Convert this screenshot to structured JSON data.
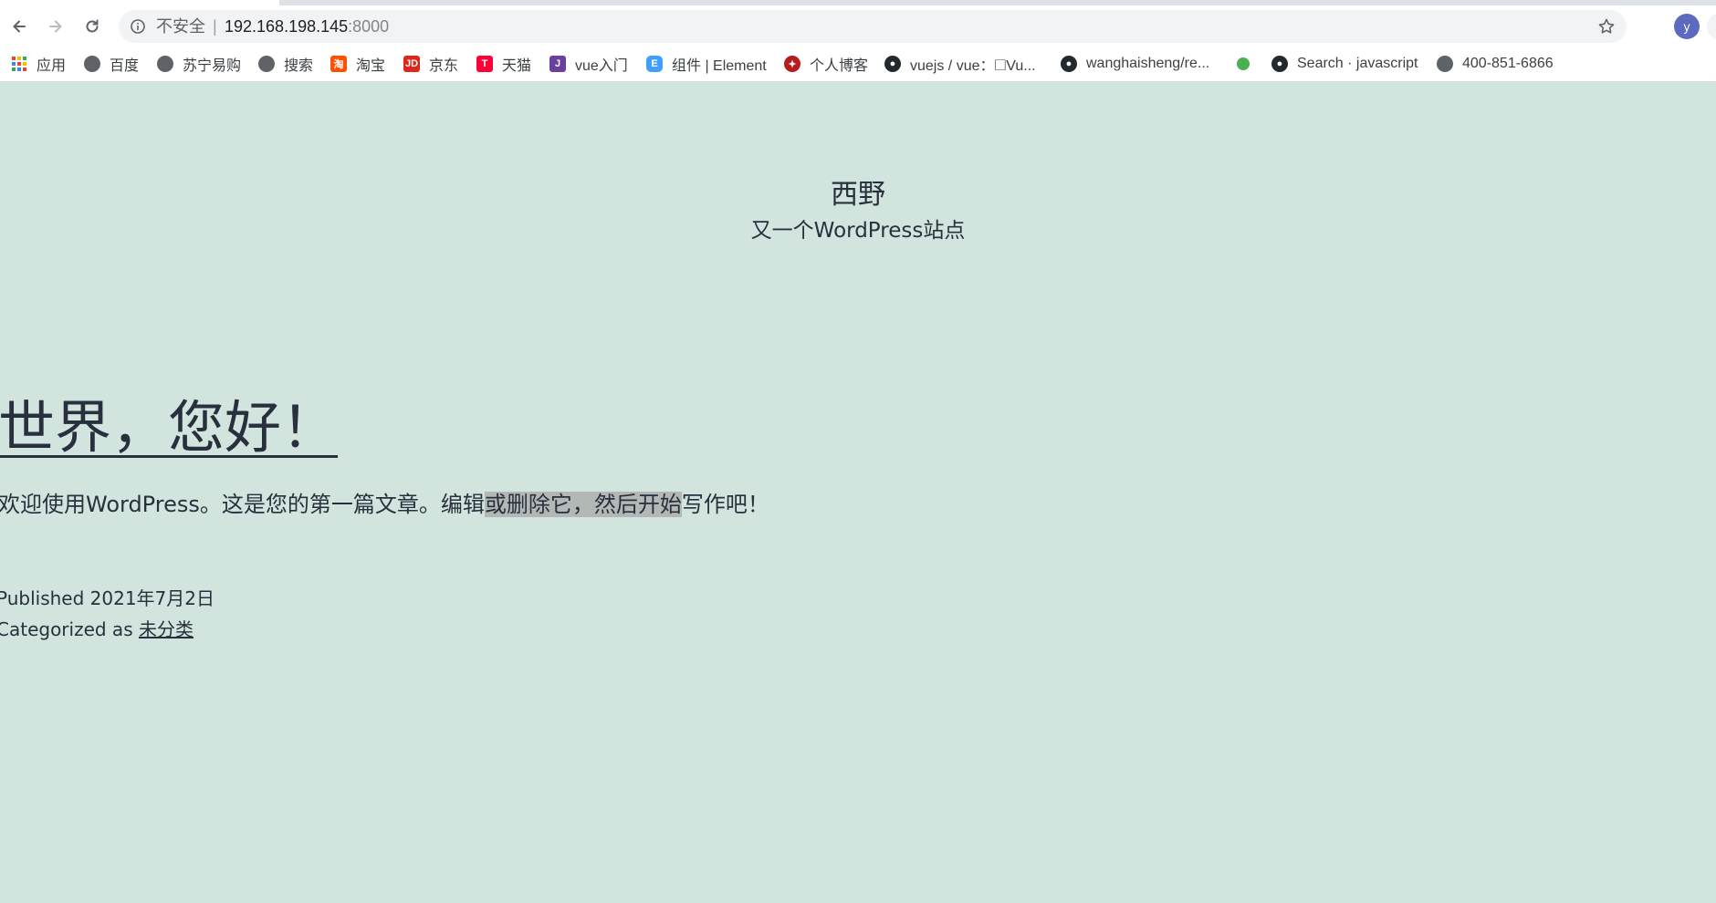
{
  "browser": {
    "address": {
      "security_label": "不安全",
      "separator": "|",
      "host": "192.168.198.145",
      "port": ":8000"
    },
    "profile_initial": "y",
    "bookmarks": [
      {
        "label": "应用",
        "icon": "apps-grid-icon"
      },
      {
        "label": "百度",
        "icon": "globe-icon"
      },
      {
        "label": "苏宁易购",
        "icon": "globe-icon"
      },
      {
        "label": "搜索",
        "icon": "globe-icon"
      },
      {
        "label": "淘宝",
        "icon": "taobao-icon"
      },
      {
        "label": "京东",
        "icon": "jd-icon"
      },
      {
        "label": "天猫",
        "icon": "tmall-icon"
      },
      {
        "label": "vue入门",
        "icon": "jetbrains-icon"
      },
      {
        "label": "组件 | Element",
        "icon": "element-icon"
      },
      {
        "label": "个人博客",
        "icon": "ninja-icon"
      },
      {
        "label": "vuejs / vue：🞎Vu...",
        "icon": "github-icon"
      },
      {
        "label": "wanghaisheng/re...",
        "icon": "github-icon"
      },
      {
        "label": "",
        "icon": "green-dot-icon"
      },
      {
        "label": "Search · javascript",
        "icon": "github-icon"
      },
      {
        "label": "400-851-6866",
        "icon": "globe-icon"
      }
    ]
  },
  "site": {
    "title": "西野",
    "description": "又一个WordPress站点"
  },
  "post": {
    "title": "世界，您好！",
    "body_before": "欢迎使用WordPress。这是您的第一篇文章。编辑",
    "body_highlight": "或删除它，然后开始",
    "body_after": "写作吧！",
    "published_label": "Published",
    "published_date": "2021年7月2日",
    "category_label": "Categorized as",
    "category": "未分类"
  },
  "colors": {
    "page_background": "#d2e4de",
    "text": "#28303d",
    "selection": "#b3b8b6"
  }
}
